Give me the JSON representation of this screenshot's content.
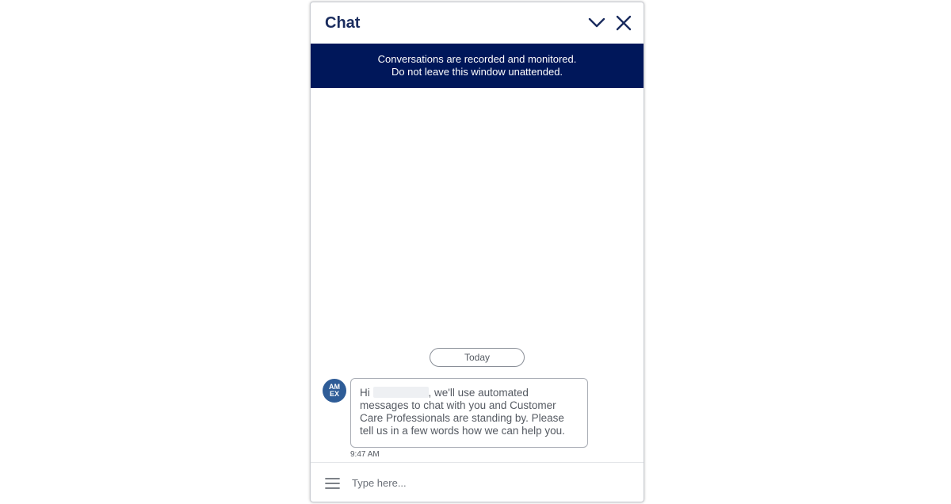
{
  "header": {
    "title": "Chat",
    "minimize_icon": "chevron-down-icon",
    "close_icon": "close-icon"
  },
  "notice": {
    "line1": "Conversations are recorded and monitored.",
    "line2": "Do not leave this window unattended."
  },
  "messages": {
    "date_label": "Today",
    "items": [
      {
        "sender_avatar": {
          "line1": "AM",
          "line2": "EX"
        },
        "greeting": "Hi",
        "text": ", we'll use automated messages to chat with you and Customer Care Professionals are standing by. Please tell us in a few words how we can help you.",
        "time": "9:47 AM"
      }
    ]
  },
  "composer": {
    "menu_icon": "hamburger-menu-icon",
    "placeholder": "Type here..."
  },
  "colors": {
    "brand_navy": "#00175a",
    "title_navy": "#1a2c5e",
    "avatar_blue": "#2e5c97"
  }
}
